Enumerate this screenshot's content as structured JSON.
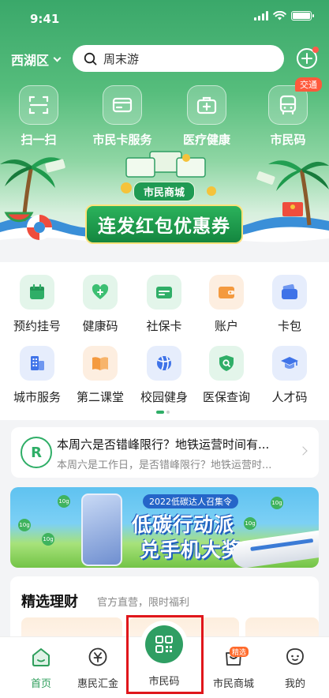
{
  "status_bar": {
    "time": "9:41"
  },
  "header": {
    "district": "西湖区",
    "search_placeholder": "周末游"
  },
  "quick_actions": [
    {
      "label": "扫一扫",
      "icon": "scan-icon"
    },
    {
      "label": "市民卡服务",
      "icon": "card-icon"
    },
    {
      "label": "医疗健康",
      "icon": "medical-kit-icon"
    },
    {
      "label": "市民码",
      "icon": "bus-icon",
      "badge": "交通"
    }
  ],
  "hero_banner": {
    "subtitle": "市民商城",
    "title": "连发红包优惠券"
  },
  "services": [
    {
      "label": "预约挂号",
      "icon": "calendar-icon",
      "bg": "#e3f5ea",
      "fg": "#2fae67"
    },
    {
      "label": "健康码",
      "icon": "heart-plus-icon",
      "bg": "#e3f5ea",
      "fg": "#3cbf72"
    },
    {
      "label": "社保卡",
      "icon": "card-icon",
      "bg": "#e3f5ea",
      "fg": "#2fae67"
    },
    {
      "label": "账户",
      "icon": "wallet-icon",
      "bg": "#fdeee0",
      "fg": "#f49a3f"
    },
    {
      "label": "卡包",
      "icon": "card-wallet-icon",
      "bg": "#e6edfc",
      "fg": "#3f73e8"
    },
    {
      "label": "城市服务",
      "icon": "building-icon",
      "bg": "#e6edfc",
      "fg": "#3f73e8"
    },
    {
      "label": "第二课堂",
      "icon": "book-icon",
      "bg": "#fdeee0",
      "fg": "#f49a3f"
    },
    {
      "label": "校园健身",
      "icon": "ball-icon",
      "bg": "#e6edfc",
      "fg": "#3f73e8"
    },
    {
      "label": "医保查询",
      "icon": "shield-search-icon",
      "bg": "#e3f5ea",
      "fg": "#2fae67"
    },
    {
      "label": "人才码",
      "icon": "graduation-cap-icon",
      "bg": "#e6edfc",
      "fg": "#3f73e8"
    }
  ],
  "news": {
    "title": "本周六是否错峰限行？地铁运营时间有...",
    "subtitle": "本周六是工作日，是否错峰限行？地铁运营时..."
  },
  "promo": {
    "tag": "2022低碳达人召集令",
    "line1": "低碳行动派",
    "line2": "兑手机大奖",
    "coin_text": "10g"
  },
  "finance": {
    "title": "精选理财",
    "subtitle": "官方直营，限时福利"
  },
  "tabbar": [
    {
      "label": "首页",
      "icon": "home-icon",
      "active": true
    },
    {
      "label": "惠民汇金",
      "icon": "coin-icon",
      "active": false
    },
    {
      "label": "市民码",
      "icon": "qr-code-icon",
      "active": false
    },
    {
      "label": "市民商城",
      "icon": "shop-bag-icon",
      "active": false,
      "badge": "精选"
    },
    {
      "label": "我的",
      "icon": "user-icon",
      "active": false
    }
  ],
  "colors": {
    "brand_green": "#2f9e63",
    "highlight_red": "#e0161b"
  }
}
